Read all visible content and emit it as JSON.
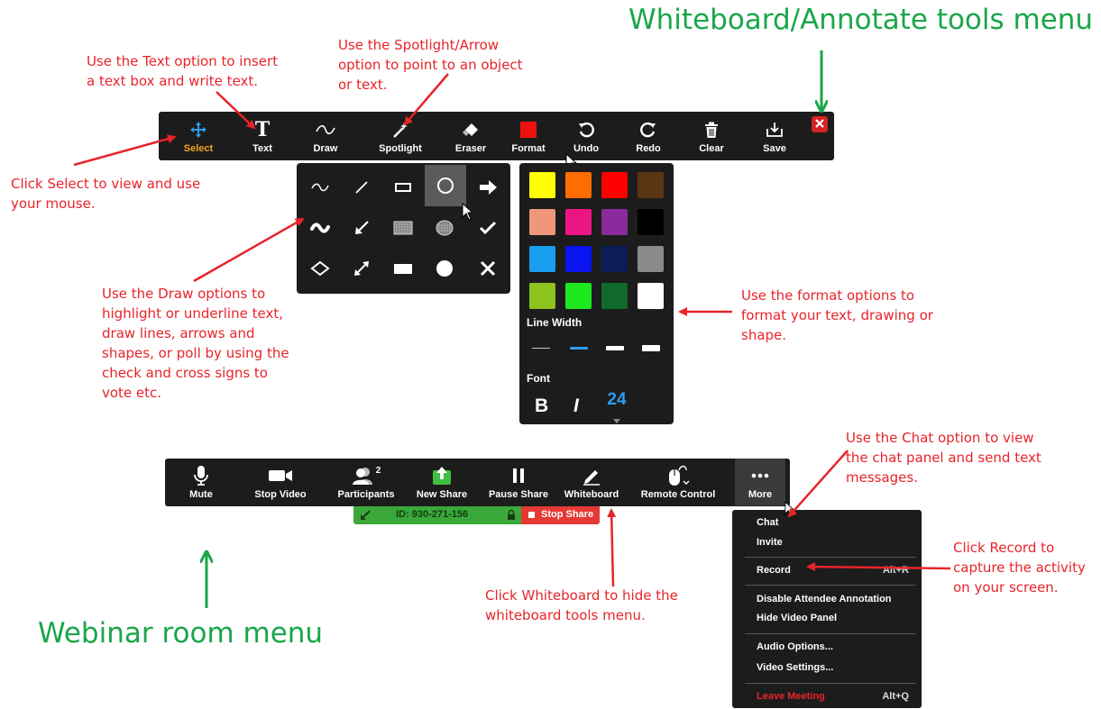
{
  "whiteboard_title": "Whiteboard/Annotate tools menu",
  "webinar_title": "Webinar room menu",
  "notes": {
    "text_option": "Use the Text option to insert\na text box and write text.",
    "spotlight_option": "Use the Spotlight/Arrow\noption to point to an object\nor text.",
    "select_option": "Click Select to view and use\nyour mouse.",
    "draw_options": "Use the Draw options to\nhighlight or underline text,\ndraw lines, arrows and\nshapes, or poll by using the\ncheck and cross signs to\nvote etc.",
    "format_options": "Use the format options to\nformat your text, drawing or\nshape.",
    "chat_option": "Use the Chat option to view\nthe chat panel and send text\nmessages.",
    "record_option": "Click Record to\ncapture the activity\non your screen.",
    "whiteboard_option": "Click Whiteboard to hide the\nwhiteboard tools menu."
  },
  "annotate_toolbar": {
    "tools": [
      {
        "label": "Select",
        "icon": "move-cross-icon",
        "active": true
      },
      {
        "label": "Text",
        "icon": "text-t-icon"
      },
      {
        "label": "Draw",
        "icon": "squiggle-icon"
      },
      {
        "label": "Spotlight",
        "icon": "magic-wand-icon"
      },
      {
        "label": "Eraser",
        "icon": "eraser-icon"
      },
      {
        "label": "Format",
        "icon": "color-square-icon"
      },
      {
        "label": "Undo",
        "icon": "undo-icon"
      },
      {
        "label": "Redo",
        "icon": "redo-icon"
      },
      {
        "label": "Clear",
        "icon": "trash-icon"
      },
      {
        "label": "Save",
        "icon": "save-tray-icon"
      }
    ],
    "close_icon": "close-icon"
  },
  "draw_palette": [
    "squiggle-line-icon",
    "straight-line-icon",
    "rectangle-outline-icon",
    "ellipse-outline-icon",
    "arrow-right-icon",
    "thick-squiggle-icon",
    "arrow-down-left-icon",
    "filled-rect-pattern-icon",
    "filled-ellipse-pattern-icon",
    "check-mark-icon",
    "diamond-outline-icon",
    "double-arrow-icon",
    "filled-rectangle-icon",
    "filled-circle-icon",
    "cross-mark-icon"
  ],
  "format_palette": {
    "colors": [
      "#ffff00",
      "#ff6d00",
      "#ff0000",
      "#5c3512",
      "#f0967a",
      "#ec1585",
      "#8a2a9c",
      "#000000",
      "#1a9ff0",
      "#0a14f0",
      "#0a1d55",
      "#8a8a8a",
      "#8dc21f",
      "#1ee81e",
      "#0f6a2c",
      "#ffffff"
    ],
    "line_width_label": "Line Width",
    "font_label": "Font",
    "bold_label": "B",
    "italic_label": "I",
    "font_size": "24"
  },
  "webinar_toolbar": {
    "buttons": [
      {
        "label": "Mute",
        "icon": "microphone-icon"
      },
      {
        "label": "Stop Video",
        "icon": "video-camera-icon"
      },
      {
        "label": "Participants",
        "icon": "participants-icon",
        "count": "2"
      },
      {
        "label": "New Share",
        "icon": "share-up-arrow-icon"
      },
      {
        "label": "Pause Share",
        "icon": "pause-icon"
      },
      {
        "label": "Whiteboard",
        "icon": "pencil-icon"
      },
      {
        "label": "Remote Control",
        "icon": "mouse-icon"
      },
      {
        "label": "More",
        "icon": "ellipsis-icon"
      }
    ],
    "share_bar": {
      "meeting_id": "ID: 930-271-156",
      "stop_share_label": "Stop Share"
    }
  },
  "more_menu": {
    "items": [
      {
        "label": "Chat"
      },
      {
        "label": "Invite"
      },
      {
        "label": "Record",
        "shortcut": "Alt+R"
      },
      {
        "label": "Disable Attendee Annotation"
      },
      {
        "label": "Hide Video Panel"
      },
      {
        "label": "Audio Options..."
      },
      {
        "label": "Video Settings..."
      },
      {
        "label": "Leave Meeting",
        "shortcut": "Alt+Q",
        "color": "#e8242a"
      }
    ]
  },
  "colors": {
    "annotation_red": "#e8242a",
    "title_green": "#1aa64a",
    "toolbar_dark": "#1c1c1c",
    "share_green": "#3aa83a",
    "stop_share_red": "#e53935",
    "select_accent": "#f2a21b"
  }
}
